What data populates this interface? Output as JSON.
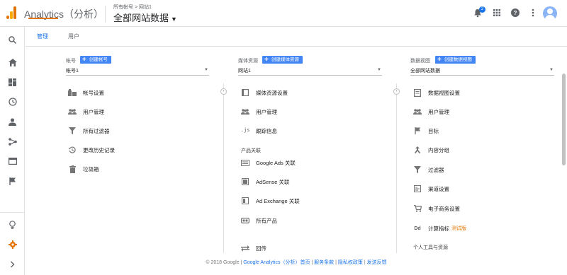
{
  "header": {
    "app_title": "Analytics（分析）",
    "breadcrumb": "所有帐号 > 网站1",
    "view_name": "全部网站数据",
    "notification_count": "2"
  },
  "rail": [
    "search-icon",
    "home-icon",
    "customization-icon",
    "realtime-icon",
    "audience-icon",
    "acquisition-icon",
    "behavior-icon",
    "conversions-icon",
    "discover-icon",
    "admin-icon",
    "expand-icon"
  ],
  "tabs": [
    "管理",
    "用户"
  ],
  "columns": {
    "account": {
      "label": "帐号",
      "create_label": "创建帐号",
      "selected": "帐号1",
      "items": [
        "帐号设置",
        "用户管理",
        "所有过滤器",
        "更改历史记录",
        "垃圾箱"
      ]
    },
    "property": {
      "label": "媒体资源",
      "create_label": "创建媒体资源",
      "selected": "网站1",
      "items": [
        "媒体资源设置",
        "用户管理",
        "跟踪信息"
      ],
      "section_label": "产品关联",
      "section_items": [
        "Google Ads 关联",
        "AdSense 关联",
        "Ad Exchange 关联",
        "所有产品"
      ],
      "extra_item": "回传"
    },
    "view": {
      "label": "数据视图",
      "create_label": "创建数据视图",
      "selected": "全部网站数据",
      "items": [
        "数据视图设置",
        "用户管理",
        "目标",
        "内容分组",
        "过滤器",
        "渠道设置",
        "电子商务设置",
        "计算指标"
      ],
      "beta_label": "测试版",
      "section_label": "个人工具与资源"
    }
  },
  "footer": {
    "copyright": "© 2018 Google",
    "sep": " | ",
    "links": [
      "Google Analytics（分析）首页",
      "服务条款",
      "隐私权政策",
      "发送反馈"
    ]
  },
  "colors": {
    "accent": "#1a73e8",
    "button": "#4285f4",
    "orange": "#e37400"
  }
}
